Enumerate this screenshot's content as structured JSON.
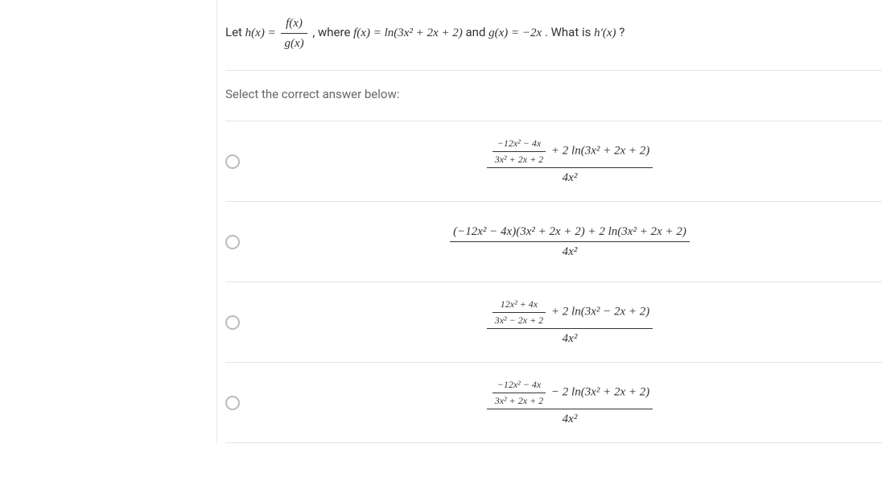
{
  "question": {
    "stem_pre": "Let ",
    "h_of_x": "h(x) = ",
    "frac_num": "f(x)",
    "frac_den": "g(x)",
    "stem_mid1": ", where ",
    "f_def": "f(x) = ln(3x² + 2x + 2)",
    "stem_mid2": " and ",
    "g_def": "g(x) = −2x",
    "stem_mid3": ". What is ",
    "h_prime": "h′(x)",
    "stem_end": "?"
  },
  "instruction": "Select the correct answer below:",
  "options": [
    {
      "inner_frac_num": "−12x² − 4x",
      "inner_frac_den": "3x² + 2x + 2",
      "outer_num_rest": " + 2 ln(3x² + 2x + 2)",
      "outer_den": "4x²"
    },
    {
      "outer_num_full": "(−12x² − 4x)(3x² + 2x + 2) + 2 ln(3x² + 2x + 2)",
      "outer_den": "4x²"
    },
    {
      "inner_frac_num": "12x² + 4x",
      "inner_frac_den": "3x² − 2x + 2",
      "outer_num_rest": " + 2 ln(3x² − 2x + 2)",
      "outer_den": "4x²"
    },
    {
      "inner_frac_num": "−12x² − 4x",
      "inner_frac_den": "3x² + 2x + 2",
      "outer_num_rest": " − 2 ln(3x² + 2x + 2)",
      "outer_den": "4x²"
    }
  ]
}
